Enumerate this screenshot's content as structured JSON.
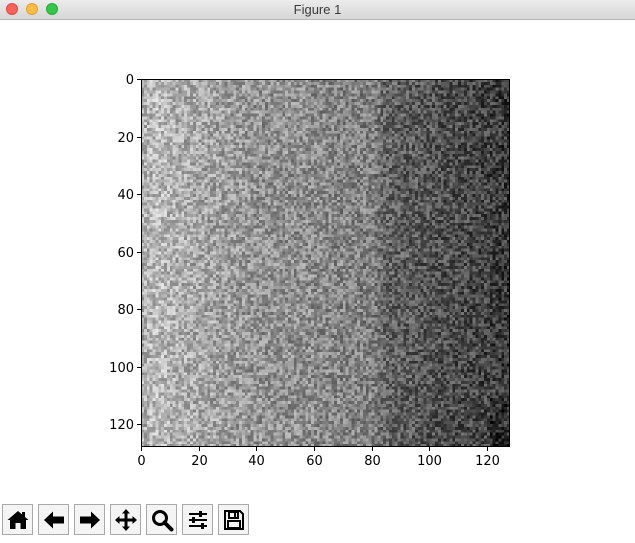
{
  "window": {
    "title": "Figure 1"
  },
  "toolbar": {
    "buttons": [
      {
        "name": "home-button",
        "icon": "home-icon"
      },
      {
        "name": "back-button",
        "icon": "arrow-left-icon"
      },
      {
        "name": "forward-button",
        "icon": "arrow-right-icon"
      },
      {
        "name": "pan-button",
        "icon": "move-arrows-icon"
      },
      {
        "name": "zoom-button",
        "icon": "magnifier-icon"
      },
      {
        "name": "configure-subplots-button",
        "icon": "sliders-icon"
      },
      {
        "name": "save-button",
        "icon": "floppy-disk-icon"
      }
    ]
  },
  "chart_data": {
    "type": "heatmap",
    "colormap": "gray",
    "title": "",
    "xlabel": "",
    "ylabel": "",
    "xlim": [
      0,
      128
    ],
    "ylim": [
      128,
      0
    ],
    "xticks": [
      0,
      20,
      40,
      60,
      80,
      100,
      120
    ],
    "yticks": [
      0,
      20,
      40,
      60,
      80,
      100,
      120
    ],
    "x_tick_labels": [
      "0",
      "20",
      "40",
      "60",
      "80",
      "100",
      "120"
    ],
    "y_tick_labels": [
      "0",
      "20",
      "40",
      "60",
      "80",
      "100",
      "120"
    ],
    "grid": false,
    "shape": [
      128,
      128
    ],
    "column_brightness_profile": {
      "x": [
        0,
        5,
        10,
        20,
        30,
        40,
        50,
        60,
        70,
        80,
        84,
        90,
        100,
        110,
        120,
        127
      ],
      "mean_intensity": [
        0.68,
        0.74,
        0.7,
        0.66,
        0.62,
        0.58,
        0.57,
        0.55,
        0.52,
        0.5,
        0.4,
        0.37,
        0.33,
        0.3,
        0.26,
        0.22
      ]
    },
    "noise_amplitude": 0.18
  }
}
